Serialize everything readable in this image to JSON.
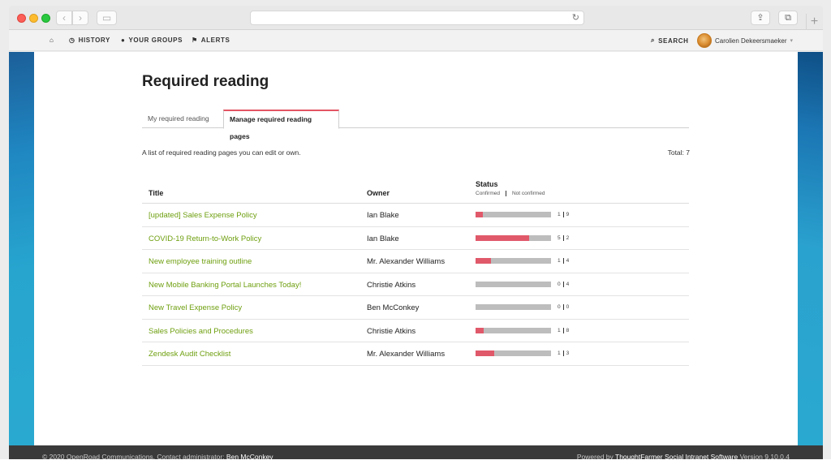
{
  "nav": {
    "history": "HISTORY",
    "groups": "YOUR GROUPS",
    "alerts": "ALERTS",
    "search": "SEARCH",
    "user": "Carolien Dekeersmaeker"
  },
  "page": {
    "title": "Required reading",
    "tabs": [
      "My required reading",
      "Manage required reading pages"
    ],
    "description": "A list of required reading pages you can edit or own.",
    "total": "Total: 7"
  },
  "table": {
    "headers": {
      "title": "Title",
      "owner": "Owner",
      "status": "Status",
      "confirmed": "Confirmed",
      "not_confirmed": "Not confirmed"
    },
    "rows": [
      {
        "title": "[updated] Sales Expense Policy",
        "owner": "Ian Blake",
        "confirmed": "1",
        "not_confirmed": "9",
        "fraction": 0.1
      },
      {
        "title": "COVID-19 Return-to-Work Policy",
        "owner": "Ian Blake",
        "confirmed": "5",
        "not_confirmed": "2",
        "fraction": 0.714
      },
      {
        "title": "New employee training outline",
        "owner": "Mr. Alexander Williams",
        "confirmed": "1",
        "not_confirmed": "4",
        "fraction": 0.2
      },
      {
        "title": "New Mobile Banking Portal Launches Today!",
        "owner": "Christie Atkins",
        "confirmed": "0",
        "not_confirmed": "4",
        "fraction": 0
      },
      {
        "title": "New Travel Expense Policy",
        "owner": "Ben McConkey",
        "confirmed": "0",
        "not_confirmed": "0",
        "fraction": 0
      },
      {
        "title": "Sales Policies and Procedures",
        "owner": "Christie Atkins",
        "confirmed": "1",
        "not_confirmed": "8",
        "fraction": 0.111
      },
      {
        "title": "Zendesk Audit Checklist",
        "owner": "Mr. Alexander Williams",
        "confirmed": "1",
        "not_confirmed": "3",
        "fraction": 0.25
      }
    ]
  },
  "footer": {
    "left_text": "© 2020 OpenRoad Communications. Contact administrator:",
    "left_link": "Ben McConkey",
    "right_text": "Powered by",
    "right_link": "ThoughtFarmer Social Intranet Software",
    "version": "Version 9.10.0.4"
  },
  "colors": {
    "accent_red": "#e0596a",
    "link_green": "#6e9f0f",
    "bar_gray": "#bdbdbd"
  }
}
